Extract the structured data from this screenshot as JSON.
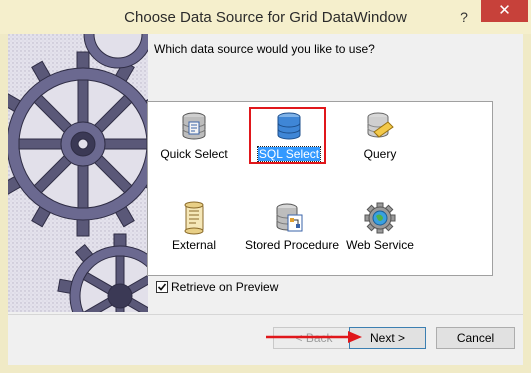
{
  "window": {
    "title": "Choose Data Source for Grid DataWindow",
    "help_label": "?",
    "close_label": "✕",
    "accent_color": "#c7413a"
  },
  "main": {
    "question": "Which data source would you like to use?",
    "selected_source": "SQL Select",
    "sources": [
      {
        "label": "Quick Select",
        "icon": "database-quick-select-icon"
      },
      {
        "label": "SQL Select",
        "icon": "database-sql-select-icon"
      },
      {
        "label": "Query",
        "icon": "query-icon"
      },
      {
        "label": "External",
        "icon": "scroll-icon"
      },
      {
        "label": "Stored Procedure",
        "icon": "stored-procedure-icon"
      },
      {
        "label": "Web Service",
        "icon": "web-service-icon"
      }
    ],
    "retrieve_on_preview": {
      "label": "Retrieve on Preview",
      "checked": true
    }
  },
  "buttons": {
    "back": "< Back",
    "next": "Next >",
    "cancel": "Cancel"
  },
  "annotation_color": "#e0171b"
}
